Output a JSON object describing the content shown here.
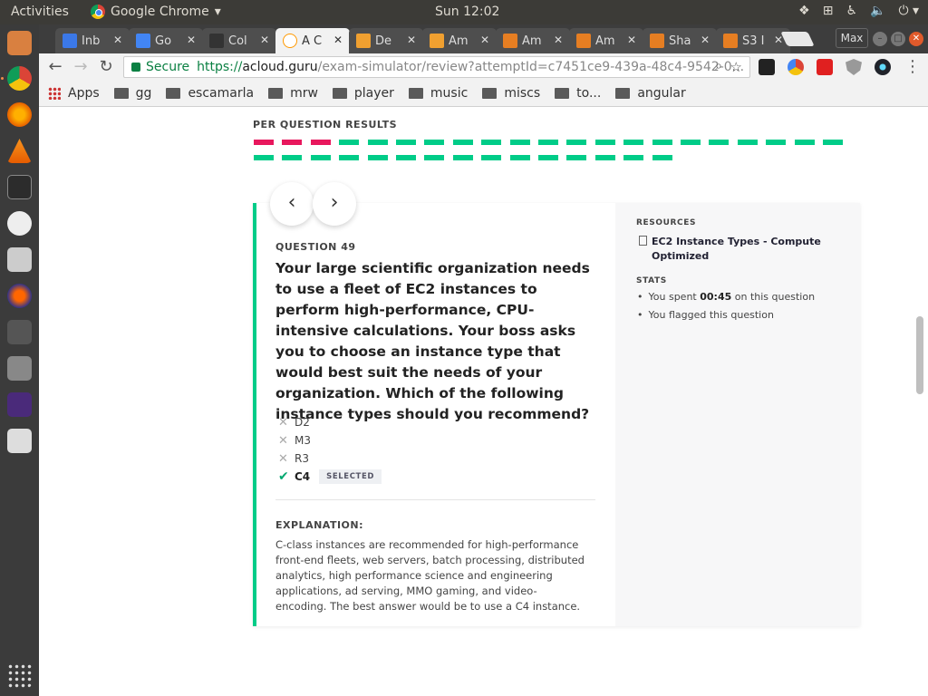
{
  "system": {
    "activities": "Activities",
    "app_name": "Google Chrome",
    "clock": "Sun 12:02"
  },
  "tabs": [
    {
      "label": "Inb",
      "active": false
    },
    {
      "label": "Go",
      "active": false
    },
    {
      "label": "Col",
      "active": false
    },
    {
      "label": "A C",
      "active": true
    },
    {
      "label": "De",
      "active": false
    },
    {
      "label": "Am",
      "active": false
    },
    {
      "label": "Am",
      "active": false
    },
    {
      "label": "Am",
      "active": false
    },
    {
      "label": "Sha",
      "active": false
    },
    {
      "label": "S3 I",
      "active": false
    }
  ],
  "window": {
    "max_label": "Max"
  },
  "address": {
    "secure_label": "Secure",
    "scheme": "https://",
    "host": "acloud.guru",
    "path": "/exam-simulator/review?attemptId=c7451ce9-439a-48c4-9542-0..."
  },
  "bookmarks": [
    {
      "label": "Apps",
      "icon": "apps-grid-icon"
    },
    {
      "label": "gg",
      "icon": "folder-icon"
    },
    {
      "label": "escamarla",
      "icon": "folder-icon"
    },
    {
      "label": "mrw",
      "icon": "folder-icon"
    },
    {
      "label": "player",
      "icon": "folder-icon"
    },
    {
      "label": "music",
      "icon": "folder-icon"
    },
    {
      "label": "miscs",
      "icon": "folder-icon"
    },
    {
      "label": "to...",
      "icon": "folder-icon"
    },
    {
      "label": "angular",
      "icon": "folder-icon"
    }
  ],
  "results": {
    "title": "PER QUESTION RESULTS",
    "rows": [
      [
        "wrong",
        "wrong",
        "wrong",
        "right",
        "right",
        "right",
        "right",
        "right",
        "right",
        "right",
        "right",
        "right",
        "right",
        "right",
        "right",
        "right",
        "right",
        "right",
        "right",
        "right",
        "right"
      ],
      [
        "right",
        "right",
        "right",
        "right",
        "right",
        "right",
        "right",
        "right",
        "right",
        "right",
        "right",
        "right",
        "right",
        "right",
        "right"
      ]
    ],
    "current_question": 49
  },
  "question": {
    "label": "QUESTION 49",
    "text": "Your large scientific organization needs to use a fleet of EC2 instances to perform high-performance, CPU-intensive calculations. Your boss asks you to choose an instance type that would best suit the needs of your organization. Which of the following instance types should you recommend?",
    "answers": [
      {
        "label": "D2",
        "correct": false
      },
      {
        "label": "M3",
        "correct": false
      },
      {
        "label": "R3",
        "correct": false
      },
      {
        "label": "C4",
        "correct": true,
        "badge": "SELECTED"
      }
    ],
    "explanation_label": "EXPLANATION:",
    "explanation": "C-class instances are recommended for high-performance front-end fleets, web servers, batch processing, distributed analytics, high performance science and engineering applications, ad serving, MMO gaming, and video-encoding. The best answer would be to use a C4 instance."
  },
  "sidebar": {
    "resources_label": "RESOURCES",
    "resource_link": "EC2 Instance Types - Compute Optimized",
    "stats_label": "STATS",
    "stat_spent_prefix": "You spent",
    "stat_spent_time": "00:45",
    "stat_spent_suffix": "on this question",
    "stat_flagged": "You flagged this question"
  },
  "colors": {
    "wrong": "#e8175d",
    "right": "#00cc88"
  }
}
